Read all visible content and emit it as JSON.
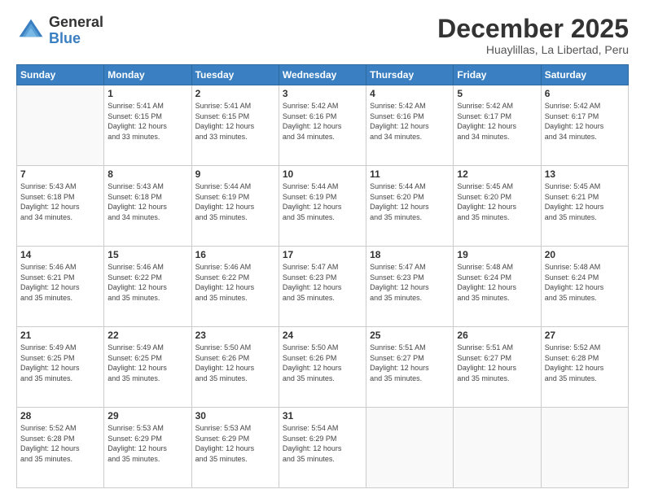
{
  "logo": {
    "general": "General",
    "blue": "Blue"
  },
  "header": {
    "title": "December 2025",
    "subtitle": "Huaylillas, La Libertad, Peru"
  },
  "weekdays": [
    "Sunday",
    "Monday",
    "Tuesday",
    "Wednesday",
    "Thursday",
    "Friday",
    "Saturday"
  ],
  "weeks": [
    [
      {
        "day": "",
        "info": ""
      },
      {
        "day": "1",
        "info": "Sunrise: 5:41 AM\nSunset: 6:15 PM\nDaylight: 12 hours\nand 33 minutes."
      },
      {
        "day": "2",
        "info": "Sunrise: 5:41 AM\nSunset: 6:15 PM\nDaylight: 12 hours\nand 33 minutes."
      },
      {
        "day": "3",
        "info": "Sunrise: 5:42 AM\nSunset: 6:16 PM\nDaylight: 12 hours\nand 34 minutes."
      },
      {
        "day": "4",
        "info": "Sunrise: 5:42 AM\nSunset: 6:16 PM\nDaylight: 12 hours\nand 34 minutes."
      },
      {
        "day": "5",
        "info": "Sunrise: 5:42 AM\nSunset: 6:17 PM\nDaylight: 12 hours\nand 34 minutes."
      },
      {
        "day": "6",
        "info": "Sunrise: 5:42 AM\nSunset: 6:17 PM\nDaylight: 12 hours\nand 34 minutes."
      }
    ],
    [
      {
        "day": "7",
        "info": "Sunrise: 5:43 AM\nSunset: 6:18 PM\nDaylight: 12 hours\nand 34 minutes."
      },
      {
        "day": "8",
        "info": "Sunrise: 5:43 AM\nSunset: 6:18 PM\nDaylight: 12 hours\nand 34 minutes."
      },
      {
        "day": "9",
        "info": "Sunrise: 5:44 AM\nSunset: 6:19 PM\nDaylight: 12 hours\nand 35 minutes."
      },
      {
        "day": "10",
        "info": "Sunrise: 5:44 AM\nSunset: 6:19 PM\nDaylight: 12 hours\nand 35 minutes."
      },
      {
        "day": "11",
        "info": "Sunrise: 5:44 AM\nSunset: 6:20 PM\nDaylight: 12 hours\nand 35 minutes."
      },
      {
        "day": "12",
        "info": "Sunrise: 5:45 AM\nSunset: 6:20 PM\nDaylight: 12 hours\nand 35 minutes."
      },
      {
        "day": "13",
        "info": "Sunrise: 5:45 AM\nSunset: 6:21 PM\nDaylight: 12 hours\nand 35 minutes."
      }
    ],
    [
      {
        "day": "14",
        "info": "Sunrise: 5:46 AM\nSunset: 6:21 PM\nDaylight: 12 hours\nand 35 minutes."
      },
      {
        "day": "15",
        "info": "Sunrise: 5:46 AM\nSunset: 6:22 PM\nDaylight: 12 hours\nand 35 minutes."
      },
      {
        "day": "16",
        "info": "Sunrise: 5:46 AM\nSunset: 6:22 PM\nDaylight: 12 hours\nand 35 minutes."
      },
      {
        "day": "17",
        "info": "Sunrise: 5:47 AM\nSunset: 6:23 PM\nDaylight: 12 hours\nand 35 minutes."
      },
      {
        "day": "18",
        "info": "Sunrise: 5:47 AM\nSunset: 6:23 PM\nDaylight: 12 hours\nand 35 minutes."
      },
      {
        "day": "19",
        "info": "Sunrise: 5:48 AM\nSunset: 6:24 PM\nDaylight: 12 hours\nand 35 minutes."
      },
      {
        "day": "20",
        "info": "Sunrise: 5:48 AM\nSunset: 6:24 PM\nDaylight: 12 hours\nand 35 minutes."
      }
    ],
    [
      {
        "day": "21",
        "info": "Sunrise: 5:49 AM\nSunset: 6:25 PM\nDaylight: 12 hours\nand 35 minutes."
      },
      {
        "day": "22",
        "info": "Sunrise: 5:49 AM\nSunset: 6:25 PM\nDaylight: 12 hours\nand 35 minutes."
      },
      {
        "day": "23",
        "info": "Sunrise: 5:50 AM\nSunset: 6:26 PM\nDaylight: 12 hours\nand 35 minutes."
      },
      {
        "day": "24",
        "info": "Sunrise: 5:50 AM\nSunset: 6:26 PM\nDaylight: 12 hours\nand 35 minutes."
      },
      {
        "day": "25",
        "info": "Sunrise: 5:51 AM\nSunset: 6:27 PM\nDaylight: 12 hours\nand 35 minutes."
      },
      {
        "day": "26",
        "info": "Sunrise: 5:51 AM\nSunset: 6:27 PM\nDaylight: 12 hours\nand 35 minutes."
      },
      {
        "day": "27",
        "info": "Sunrise: 5:52 AM\nSunset: 6:28 PM\nDaylight: 12 hours\nand 35 minutes."
      }
    ],
    [
      {
        "day": "28",
        "info": "Sunrise: 5:52 AM\nSunset: 6:28 PM\nDaylight: 12 hours\nand 35 minutes."
      },
      {
        "day": "29",
        "info": "Sunrise: 5:53 AM\nSunset: 6:29 PM\nDaylight: 12 hours\nand 35 minutes."
      },
      {
        "day": "30",
        "info": "Sunrise: 5:53 AM\nSunset: 6:29 PM\nDaylight: 12 hours\nand 35 minutes."
      },
      {
        "day": "31",
        "info": "Sunrise: 5:54 AM\nSunset: 6:29 PM\nDaylight: 12 hours\nand 35 minutes."
      },
      {
        "day": "",
        "info": ""
      },
      {
        "day": "",
        "info": ""
      },
      {
        "day": "",
        "info": ""
      }
    ]
  ]
}
